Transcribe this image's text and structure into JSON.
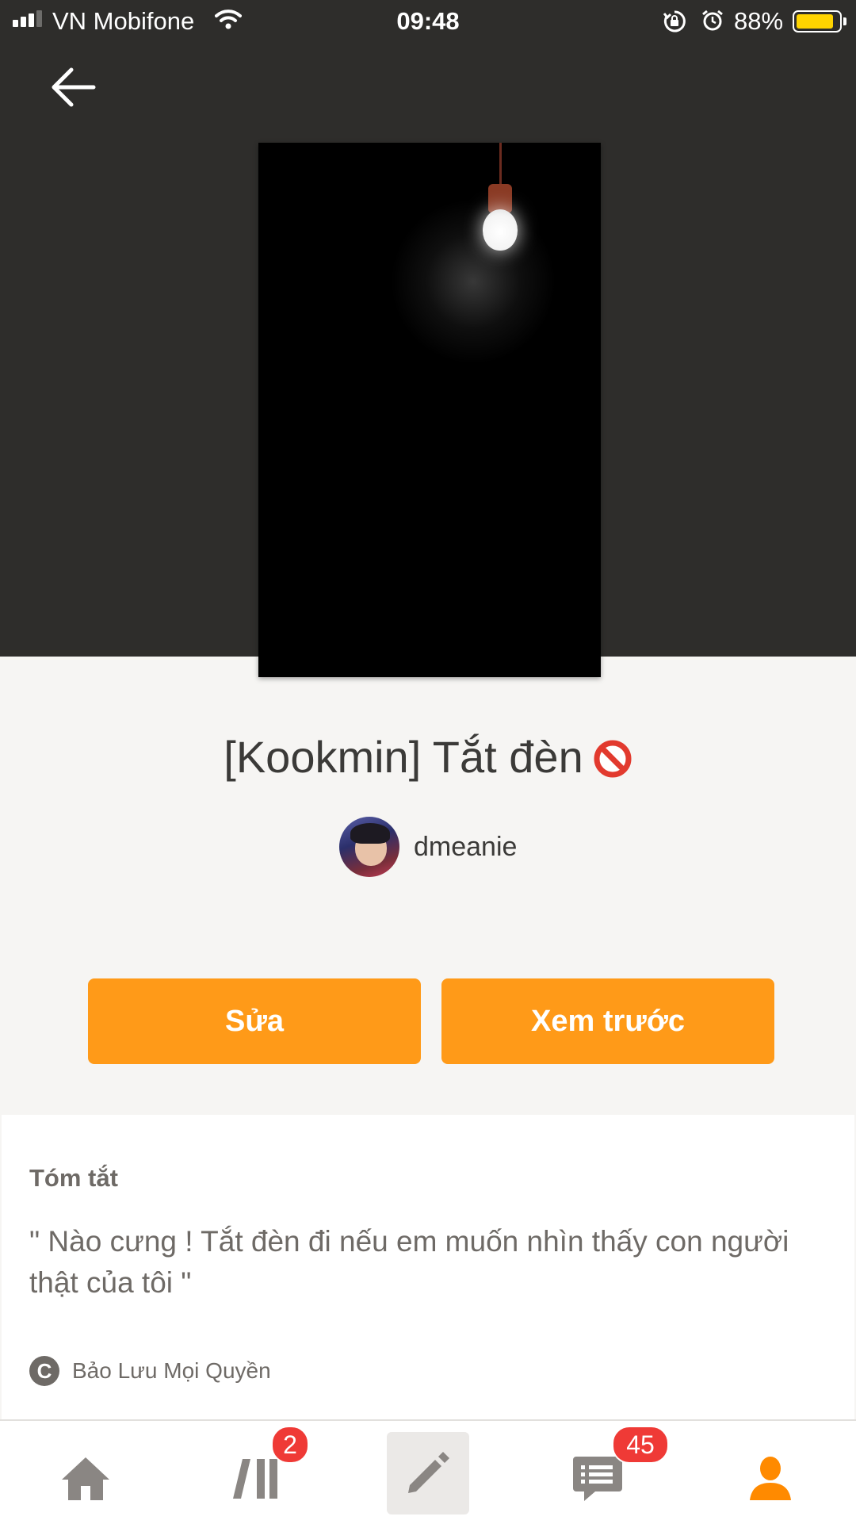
{
  "status_bar": {
    "carrier": "VN Mobifone",
    "time": "09:48",
    "battery_percent": "88%",
    "battery_level": 0.88,
    "icons": [
      "signal-icon",
      "wifi-icon",
      "orientation-lock-icon",
      "alarm-icon",
      "battery-icon"
    ]
  },
  "header": {
    "back_icon": "arrow-left-icon"
  },
  "story": {
    "title": "[Kookmin] Tắt đèn",
    "title_emoji_icon": "no-entry-sign-icon",
    "author": "dmeanie"
  },
  "actions": {
    "edit_label": "Sửa",
    "preview_label": "Xem trước"
  },
  "summary": {
    "heading": "Tóm tắt",
    "text": "\" Nào cưng ! Tắt đèn đi nếu em muốn nhìn thấy con người thật của tôi \"",
    "copyright_symbol": "C",
    "copyright": "Bảo Lưu Mọi Quyền"
  },
  "tab_bar": {
    "items": [
      {
        "name": "home",
        "icon": "home-icon"
      },
      {
        "name": "library",
        "icon": "library-icon",
        "badge": "2"
      },
      {
        "name": "write",
        "icon": "pencil-icon",
        "active": true
      },
      {
        "name": "messages",
        "icon": "message-icon",
        "badge": "45"
      },
      {
        "name": "profile",
        "icon": "person-icon"
      }
    ]
  },
  "colors": {
    "accent": "#ff9a18",
    "hero_bg": "#2e2d2b",
    "badge": "#ef3a36",
    "page_bg": "#f6f5f3"
  }
}
